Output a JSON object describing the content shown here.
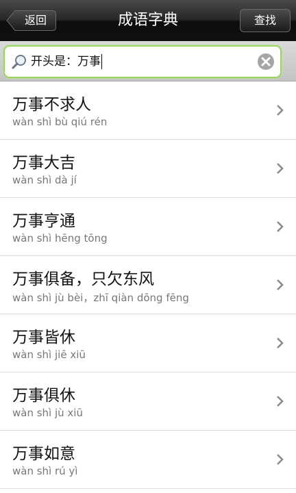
{
  "header": {
    "back_label": "返回",
    "title": "成语字典",
    "find_label": "查找"
  },
  "search": {
    "value": "开头是：万事",
    "icons": [
      "search-icon",
      "clear-icon"
    ],
    "border_color": "#9bd35f"
  },
  "list": {
    "items": [
      {
        "idiom": "万事不求人",
        "pinyin": "wàn  shì  bù  qiú  rén"
      },
      {
        "idiom": "万事大吉",
        "pinyin": "wàn shì dà jí"
      },
      {
        "idiom": "万事亨通",
        "pinyin": "wàn shì hēng tōng"
      },
      {
        "idiom": "万事俱备，只欠东风",
        "pinyin": "wàn shì jù bèi，zhī qiàn dōng fēng"
      },
      {
        "idiom": "万事皆休",
        "pinyin": "wàn  shì  jiē  xiū"
      },
      {
        "idiom": "万事俱休",
        "pinyin": "wàn  shì  jù  xiū"
      },
      {
        "idiom": "万事如意",
        "pinyin": "wàn  shì  rú  yì"
      }
    ],
    "chevron_icon": "chevron-right-icon"
  }
}
